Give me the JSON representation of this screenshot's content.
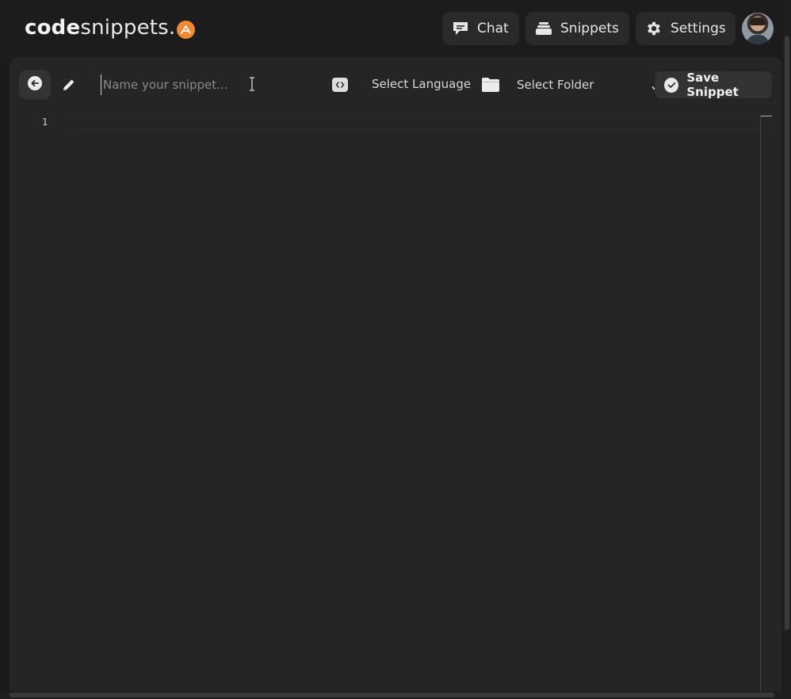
{
  "brand": {
    "bold": "code",
    "light": "snippets."
  },
  "nav": {
    "chat_label": "Chat",
    "snippets_label": "Snippets",
    "settings_label": "Settings"
  },
  "toolbar": {
    "name_placeholder": "Name your snippet...",
    "name_value": "",
    "language_label": "Select Language",
    "folder_label": "Select Folder",
    "save_label": "Save Snippet"
  },
  "editor": {
    "line_numbers": [
      "1"
    ]
  },
  "icons": {
    "back": "back-arrow-icon",
    "edit": "pencil-icon",
    "language": "code-icon",
    "folder": "folder-icon",
    "chevron": "chevron-down-icon",
    "save": "check-circle-icon",
    "chat": "chat-bubble-icon",
    "snippets": "stack-icon",
    "settings": "gear-icon"
  },
  "colors": {
    "accent": "#f2892d",
    "background": "#1c1c1c",
    "panel": "#252525"
  }
}
